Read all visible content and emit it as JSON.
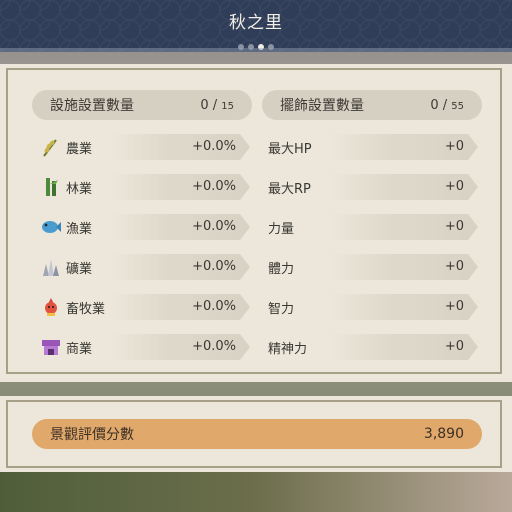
{
  "title": "秋之里",
  "pagination": {
    "total": 3,
    "active_index": 2
  },
  "facilities": {
    "header": {
      "label": "設施設置數量",
      "current": "0",
      "max": "15"
    },
    "rows": [
      {
        "icon": "wheat-icon",
        "label": "農業",
        "value": "+0.0%"
      },
      {
        "icon": "bamboo-icon",
        "label": "林業",
        "value": "+0.0%"
      },
      {
        "icon": "fish-icon",
        "label": "漁業",
        "value": "+0.0%"
      },
      {
        "icon": "crystal-icon",
        "label": "礦業",
        "value": "+0.0%"
      },
      {
        "icon": "livestock-icon",
        "label": "畜牧業",
        "value": "+0.0%"
      },
      {
        "icon": "shop-icon",
        "label": "商業",
        "value": "+0.0%"
      }
    ]
  },
  "decorations": {
    "header": {
      "label": "擺飾設置數量",
      "current": "0",
      "max": "55"
    },
    "rows": [
      {
        "label": "最大HP",
        "value": "+0"
      },
      {
        "label": "最大RP",
        "value": "+0"
      },
      {
        "label": "力量",
        "value": "+0"
      },
      {
        "label": "體力",
        "value": "+0"
      },
      {
        "label": "智力",
        "value": "+0"
      },
      {
        "label": "精神力",
        "value": "+0"
      }
    ]
  },
  "score": {
    "label": "景觀評價分數",
    "value": "3,890"
  },
  "colors": {
    "title_bar": "#2f3d58",
    "panel": "#ece7da",
    "pill": "#d6d0c2",
    "score_pill": "#e0a86a"
  }
}
